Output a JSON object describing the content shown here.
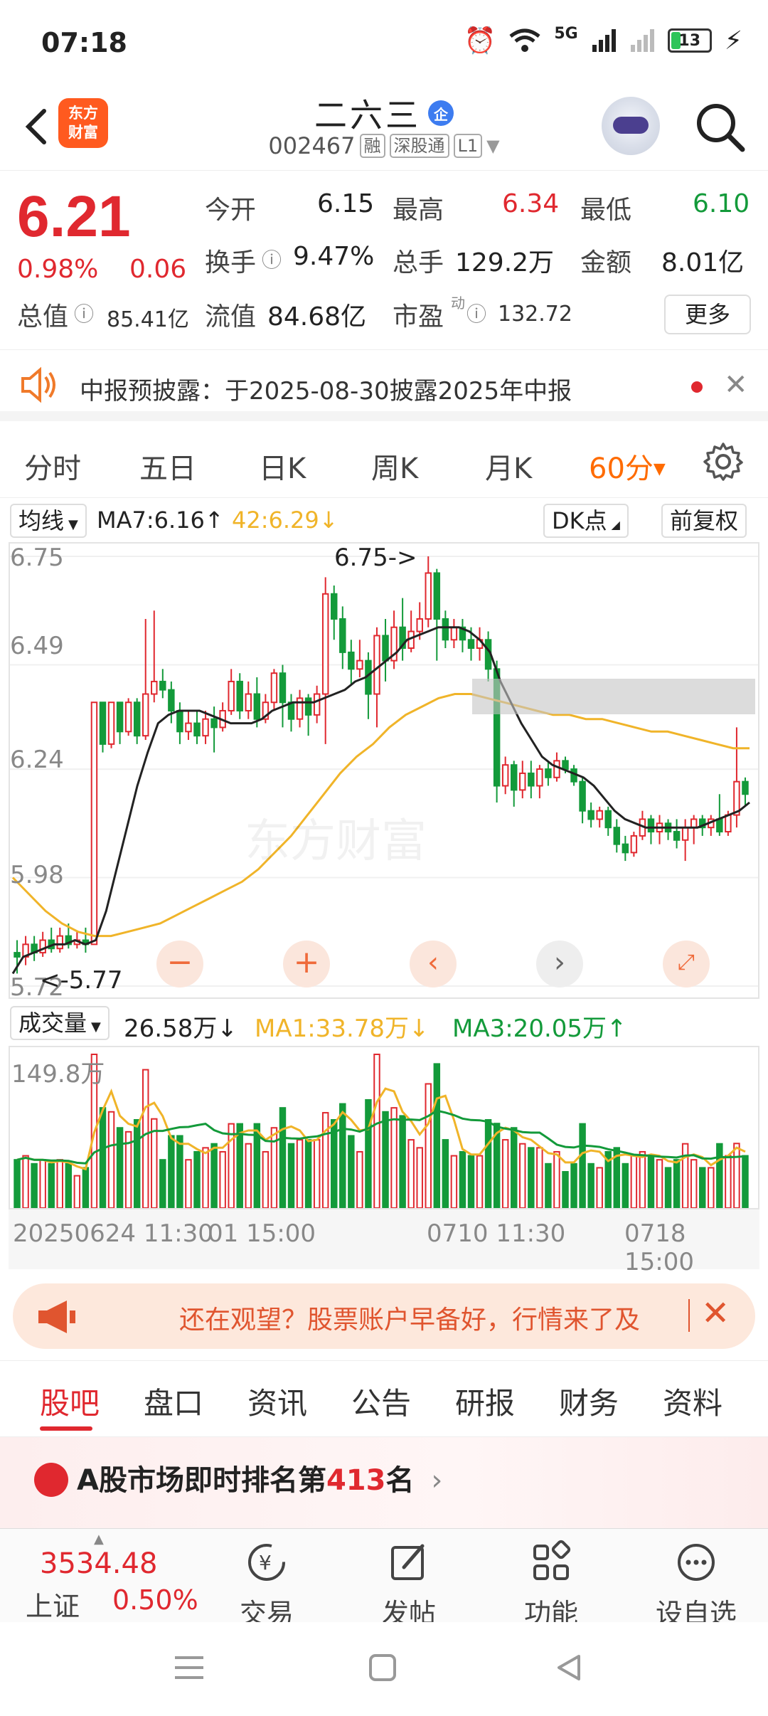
{
  "status_bar": {
    "time": "07:18",
    "network": "5G",
    "battery": "13"
  },
  "header": {
    "brand": [
      "东方",
      "财富"
    ],
    "stock_name": "二六三",
    "enterprise_badge": "企",
    "stock_code": "002467",
    "tags": [
      "融",
      "深股通",
      "L1"
    ]
  },
  "quote": {
    "price": "6.21",
    "change_pct": "0.98%",
    "change_amt": "0.06",
    "open_label": "今开",
    "open": "6.15",
    "high_label": "最高",
    "high": "6.34",
    "low_label": "最低",
    "low": "6.10",
    "turnover_label": "换手",
    "turnover": "9.47%",
    "volume_label": "总手",
    "volume": "129.2万",
    "amount_label": "金额",
    "amount": "8.01亿",
    "mktcap_label": "总值",
    "mktcap": "85.41亿",
    "float_label": "流值",
    "float": "84.68亿",
    "pe_label": "市盈",
    "pe_sup": "动",
    "pe": "132.72",
    "more": "更多"
  },
  "notice": {
    "text": "中报预披露：于2025-08-30披露2025年中报"
  },
  "period_tabs": [
    "分时",
    "五日",
    "日K",
    "周K",
    "月K"
  ],
  "period_active": "60分",
  "indicator": {
    "selector": "均线",
    "ma7": "MA7:6.16",
    "ma42": "42:6.29",
    "dk_button": "DK点",
    "adjust_button": "前复权"
  },
  "kline": {
    "y_ticks": [
      "6.75",
      "6.49",
      "6.24",
      "5.98",
      "5.72"
    ],
    "high_marker": "6.75->",
    "low_marker": "<-5.77"
  },
  "volume": {
    "selector": "成交量",
    "current": "26.58万",
    "ma1": "MA1:33.78万",
    "ma3": "MA3:20.05万",
    "max_label": "149.8万"
  },
  "time_axis": [
    "20250624 11:30",
    "01 15:00",
    "0710 11:30",
    "0718 15:00"
  ],
  "promo": {
    "text": "还在观望？股票账户早备好，行情来了及"
  },
  "section_tabs": [
    "股吧",
    "盘口",
    "资讯",
    "公告",
    "研报",
    "财务",
    "资料"
  ],
  "rank": {
    "prefix": "A股市场即时排名第",
    "rank": "413",
    "suffix": "名"
  },
  "bottom_bar": {
    "index_value": "3534.48",
    "index_name": "上证",
    "index_change": "0.50%",
    "items": [
      "交易",
      "发帖",
      "功能",
      "设自选"
    ]
  },
  "colors": {
    "up": "#e0282f",
    "down": "#139a3a",
    "ma_short": "#222222",
    "ma_long": "#f0b429",
    "accent": "#ff6b00"
  },
  "chart_data": {
    "type": "candlestick",
    "y_ticks": [
      6.75,
      6.49,
      6.24,
      5.98,
      5.72
    ],
    "ylim": [
      5.72,
      6.75
    ],
    "candles": [
      [
        5.8,
        5.79,
        5.83,
        5.75
      ],
      [
        5.79,
        5.82,
        5.84,
        5.77
      ],
      [
        5.82,
        5.8,
        5.84,
        5.78
      ],
      [
        5.8,
        5.83,
        5.85,
        5.79
      ],
      [
        5.83,
        5.81,
        5.86,
        5.8
      ],
      [
        5.81,
        5.84,
        5.86,
        5.8
      ],
      [
        5.84,
        5.82,
        5.87,
        5.81
      ],
      [
        5.82,
        5.83,
        5.85,
        5.81
      ],
      [
        5.83,
        5.82,
        5.86,
        5.8
      ],
      [
        5.82,
        6.4,
        6.4,
        5.82
      ],
      [
        6.4,
        6.3,
        6.4,
        6.28
      ],
      [
        6.3,
        6.4,
        6.4,
        6.29
      ],
      [
        6.4,
        6.33,
        6.4,
        6.3
      ],
      [
        6.33,
        6.4,
        6.41,
        6.32
      ],
      [
        6.4,
        6.32,
        6.41,
        6.3
      ],
      [
        6.32,
        6.42,
        6.6,
        6.31
      ],
      [
        6.42,
        6.45,
        6.62,
        6.4
      ],
      [
        6.45,
        6.43,
        6.48,
        6.41
      ],
      [
        6.43,
        6.38,
        6.45,
        6.35
      ],
      [
        6.38,
        6.33,
        6.4,
        6.3
      ],
      [
        6.33,
        6.35,
        6.38,
        6.31
      ],
      [
        6.35,
        6.32,
        6.38,
        6.3
      ],
      [
        6.32,
        6.36,
        6.38,
        6.3
      ],
      [
        6.36,
        6.34,
        6.39,
        6.28
      ],
      [
        6.34,
        6.38,
        6.4,
        6.33
      ],
      [
        6.38,
        6.45,
        6.48,
        6.37
      ],
      [
        6.45,
        6.38,
        6.47,
        6.36
      ],
      [
        6.38,
        6.42,
        6.45,
        6.36
      ],
      [
        6.42,
        6.36,
        6.46,
        6.34
      ],
      [
        6.36,
        6.4,
        6.42,
        6.35
      ],
      [
        6.4,
        6.47,
        6.48,
        6.38
      ],
      [
        6.47,
        6.4,
        6.49,
        6.34
      ],
      [
        6.4,
        6.36,
        6.42,
        6.33
      ],
      [
        6.36,
        6.41,
        6.43,
        6.34
      ],
      [
        6.41,
        6.37,
        6.42,
        6.32
      ],
      [
        6.37,
        6.42,
        6.44,
        6.35
      ],
      [
        6.42,
        6.66,
        6.7,
        6.3
      ],
      [
        6.66,
        6.6,
        6.68,
        6.55
      ],
      [
        6.6,
        6.52,
        6.63,
        6.48
      ],
      [
        6.52,
        6.48,
        6.55,
        6.44
      ],
      [
        6.48,
        6.5,
        6.55,
        6.46
      ],
      [
        6.5,
        6.42,
        6.52,
        6.36
      ],
      [
        6.42,
        6.56,
        6.58,
        6.34
      ],
      [
        6.56,
        6.5,
        6.6,
        6.45
      ],
      [
        6.5,
        6.58,
        6.62,
        6.48
      ],
      [
        6.58,
        6.53,
        6.65,
        6.5
      ],
      [
        6.53,
        6.57,
        6.62,
        6.52
      ],
      [
        6.57,
        6.6,
        6.64,
        6.55
      ],
      [
        6.6,
        6.71,
        6.75,
        6.58
      ],
      [
        6.71,
        6.6,
        6.72,
        6.5
      ],
      [
        6.6,
        6.55,
        6.62,
        6.53
      ],
      [
        6.55,
        6.58,
        6.6,
        6.53
      ],
      [
        6.58,
        6.55,
        6.6,
        6.52
      ],
      [
        6.55,
        6.53,
        6.58,
        6.5
      ],
      [
        6.53,
        6.55,
        6.58,
        6.5
      ],
      [
        6.55,
        6.48,
        6.57,
        6.45
      ],
      [
        6.48,
        6.2,
        6.5,
        6.16
      ],
      [
        6.2,
        6.25,
        6.27,
        6.18
      ],
      [
        6.25,
        6.19,
        6.26,
        6.15
      ],
      [
        6.19,
        6.23,
        6.26,
        6.17
      ],
      [
        6.23,
        6.2,
        6.26,
        6.17
      ],
      [
        6.2,
        6.24,
        6.25,
        6.17
      ],
      [
        6.24,
        6.22,
        6.26,
        6.2
      ],
      [
        6.22,
        6.26,
        6.28,
        6.21
      ],
      [
        6.26,
        6.24,
        6.27,
        6.23
      ],
      [
        6.24,
        6.21,
        6.25,
        6.2
      ],
      [
        6.21,
        6.14,
        6.22,
        6.11
      ],
      [
        6.14,
        6.12,
        6.16,
        6.1
      ],
      [
        6.12,
        6.14,
        6.15,
        6.1
      ],
      [
        6.14,
        6.1,
        6.15,
        6.08
      ],
      [
        6.1,
        6.06,
        6.12,
        6.04
      ],
      [
        6.06,
        6.04,
        6.08,
        6.02
      ],
      [
        6.04,
        6.08,
        6.09,
        6.03
      ],
      [
        6.08,
        6.12,
        6.14,
        6.07
      ],
      [
        6.12,
        6.09,
        6.13,
        6.06
      ],
      [
        6.09,
        6.11,
        6.13,
        6.06
      ],
      [
        6.11,
        6.09,
        6.12,
        6.07
      ],
      [
        6.09,
        6.07,
        6.12,
        6.05
      ],
      [
        6.07,
        6.1,
        6.12,
        6.02
      ],
      [
        6.1,
        6.12,
        6.13,
        6.06
      ],
      [
        6.12,
        6.1,
        6.13,
        6.08
      ],
      [
        6.1,
        6.12,
        6.13,
        6.08
      ],
      [
        6.12,
        6.09,
        6.18,
        6.08
      ],
      [
        6.09,
        6.13,
        6.14,
        6.08
      ],
      [
        6.13,
        6.21,
        6.34,
        6.1
      ],
      [
        6.21,
        6.18,
        6.22,
        6.15
      ]
    ],
    "ma_short_values": [
      5.75,
      5.79,
      5.8,
      5.81,
      5.82,
      5.82,
      5.83,
      5.82,
      5.83,
      5.9,
      6.0,
      6.1,
      6.2,
      6.28,
      6.35,
      6.37,
      6.38,
      6.38,
      6.38,
      6.37,
      6.36,
      6.35,
      6.35,
      6.35,
      6.36,
      6.38,
      6.39,
      6.4,
      6.4,
      6.4,
      6.41,
      6.42,
      6.43,
      6.45,
      6.46,
      6.48,
      6.5,
      6.52,
      6.55,
      6.56,
      6.57,
      6.58,
      6.58,
      6.58,
      6.57,
      6.55,
      6.52,
      6.45,
      6.4,
      6.35,
      6.31,
      6.27,
      6.25,
      6.24,
      6.23,
      6.22,
      6.2,
      6.17,
      6.14,
      6.12,
      6.11,
      6.1,
      6.1,
      6.1,
      6.1,
      6.1,
      6.1,
      6.11,
      6.12,
      6.13,
      6.14,
      6.16
    ],
    "ma_long_values": [
      5.98,
      5.94,
      5.9,
      5.87,
      5.85,
      5.84,
      5.84,
      5.85,
      5.86,
      5.87,
      5.89,
      5.91,
      5.93,
      5.95,
      5.97,
      6.0,
      6.04,
      6.08,
      6.13,
      6.18,
      6.23,
      6.27,
      6.3,
      6.34,
      6.37,
      6.39,
      6.41,
      6.42,
      6.42,
      6.41,
      6.4,
      6.39,
      6.38,
      6.37,
      6.37,
      6.36,
      6.36,
      6.35,
      6.34,
      6.33,
      6.33,
      6.32,
      6.31,
      6.3,
      6.29,
      6.29
    ],
    "volume_max": 149.8
  }
}
